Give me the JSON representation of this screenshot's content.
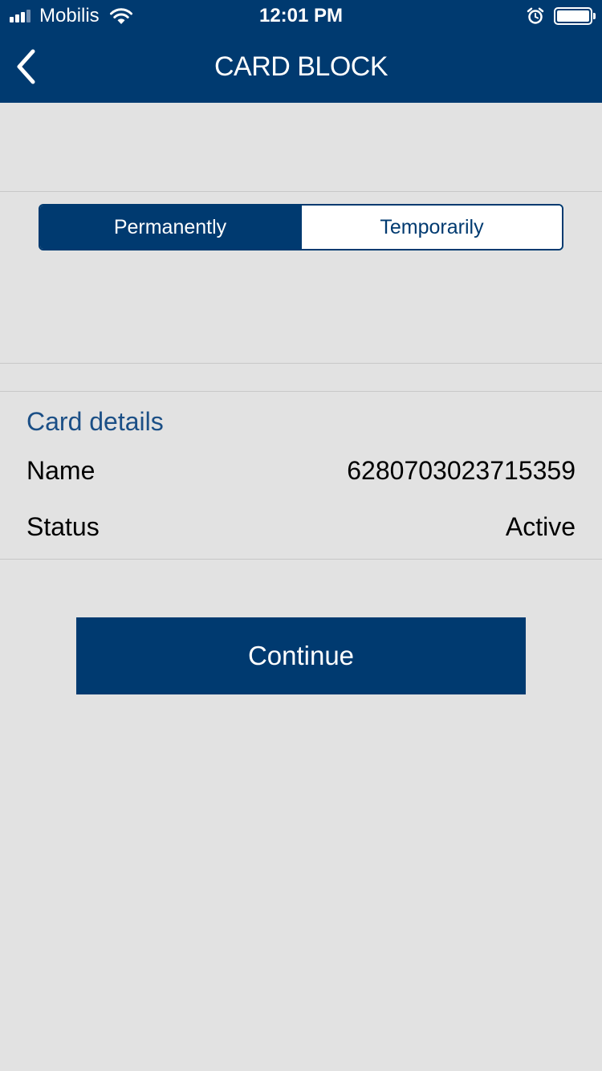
{
  "status_bar": {
    "carrier": "Mobilis",
    "time": "12:01 PM",
    "icons": [
      "signal-icon",
      "wifi-icon",
      "alarm-icon",
      "battery-icon"
    ]
  },
  "nav": {
    "title": "CARD BLOCK",
    "back_icon": "chevron-left-icon"
  },
  "block_type": {
    "options": [
      "Permanently",
      "Temporarily"
    ],
    "selected": "Permanently"
  },
  "card_details": {
    "title": "Card details",
    "rows": [
      {
        "label": "Name",
        "value": "6280703023715359"
      },
      {
        "label": "Status",
        "value": "Active"
      }
    ]
  },
  "actions": {
    "continue_label": "Continue"
  },
  "colors": {
    "primary": "#003a70",
    "background": "#e2e2e2",
    "section_title": "#1b4f86",
    "divider": "#c8c8c8"
  }
}
